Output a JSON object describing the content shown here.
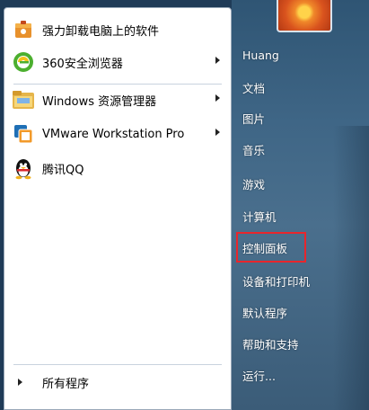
{
  "left_panel": {
    "programs": [
      {
        "label": "强力卸载电脑上的软件",
        "icon": "uninstall-box-icon",
        "has_submenu": false
      },
      {
        "label": "360安全浏览器",
        "icon": "browser-360-icon",
        "has_submenu": true
      },
      {
        "label": "Windows 资源管理器",
        "icon": "folder-explorer-icon",
        "has_submenu": true
      },
      {
        "label": "VMware Workstation Pro",
        "icon": "vmware-icon",
        "has_submenu": true
      },
      {
        "label": "腾讯QQ",
        "icon": "qq-penguin-icon",
        "has_submenu": false
      }
    ],
    "all_programs": "所有程序"
  },
  "right_panel": {
    "items": [
      {
        "label": "Huang"
      },
      {
        "label": "文档"
      },
      {
        "label": "图片"
      },
      {
        "label": "音乐"
      },
      {
        "label": "游戏"
      },
      {
        "label": "计算机"
      },
      {
        "label": "控制面板",
        "highlighted": true
      },
      {
        "label": "设备和打印机"
      },
      {
        "label": "默认程序"
      },
      {
        "label": "帮助和支持"
      },
      {
        "label": "运行..."
      }
    ]
  },
  "colors": {
    "highlight_border": "#e8262c",
    "right_panel": "#3f6686",
    "left_panel": "#ffffff"
  }
}
